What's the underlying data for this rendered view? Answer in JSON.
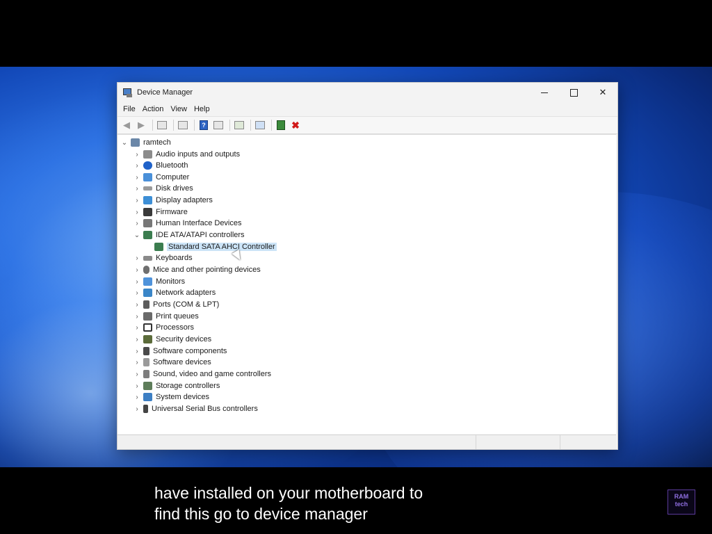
{
  "window": {
    "title": "Device Manager",
    "controls": {
      "minimize": "",
      "maximize": "",
      "close": "✕"
    }
  },
  "menu": [
    "File",
    "Action",
    "View",
    "Help"
  ],
  "toolbar": {
    "icons": [
      "back-arrow-icon",
      "forward-arrow-icon",
      "show-hide-console-tree-icon",
      "properties-icon",
      "help-icon",
      "show-action-pane-icon",
      "update-driver-icon",
      "scan-hardware-icon",
      "enable-device-icon",
      "uninstall-device-icon"
    ]
  },
  "tree": {
    "root": "ramtech",
    "categories": [
      {
        "label": "Audio inputs and outputs",
        "icon": "speaker-icon",
        "expanded": false
      },
      {
        "label": "Bluetooth",
        "icon": "bluetooth-icon",
        "expanded": false
      },
      {
        "label": "Computer",
        "icon": "computer-icon",
        "expanded": false
      },
      {
        "label": "Disk drives",
        "icon": "disk-drive-icon",
        "expanded": false
      },
      {
        "label": "Display adapters",
        "icon": "display-adapter-icon",
        "expanded": false
      },
      {
        "label": "Firmware",
        "icon": "firmware-icon",
        "expanded": false
      },
      {
        "label": "Human Interface Devices",
        "icon": "hid-icon",
        "expanded": false
      },
      {
        "label": "IDE ATA/ATAPI controllers",
        "icon": "ide-controller-icon",
        "expanded": true
      },
      {
        "label": "Keyboards",
        "icon": "keyboard-icon",
        "expanded": false
      },
      {
        "label": "Mice and other pointing devices",
        "icon": "mouse-icon",
        "expanded": false
      },
      {
        "label": "Monitors",
        "icon": "monitor-icon",
        "expanded": false
      },
      {
        "label": "Network adapters",
        "icon": "network-icon",
        "expanded": false
      },
      {
        "label": "Ports (COM & LPT)",
        "icon": "port-icon",
        "expanded": false
      },
      {
        "label": "Print queues",
        "icon": "printer-icon",
        "expanded": false
      },
      {
        "label": "Processors",
        "icon": "processor-icon",
        "expanded": false
      },
      {
        "label": "Security devices",
        "icon": "security-icon",
        "expanded": false
      },
      {
        "label": "Software components",
        "icon": "software-component-icon",
        "expanded": false
      },
      {
        "label": "Software devices",
        "icon": "software-device-icon",
        "expanded": false
      },
      {
        "label": "Sound, video and game controllers",
        "icon": "sound-icon",
        "expanded": false
      },
      {
        "label": "Storage controllers",
        "icon": "storage-icon",
        "expanded": false
      },
      {
        "label": "System devices",
        "icon": "system-icon",
        "expanded": false
      },
      {
        "label": "Universal Serial Bus controllers",
        "icon": "usb-icon",
        "expanded": false
      }
    ],
    "ide_children": [
      "Standard SATA AHCI Controller"
    ],
    "selected": "Standard SATA AHCI Controller"
  },
  "subtitle": {
    "line1": "have installed on your motherboard to",
    "line2": "find this go to device manager"
  },
  "logo": {
    "text": "RAM tech"
  }
}
